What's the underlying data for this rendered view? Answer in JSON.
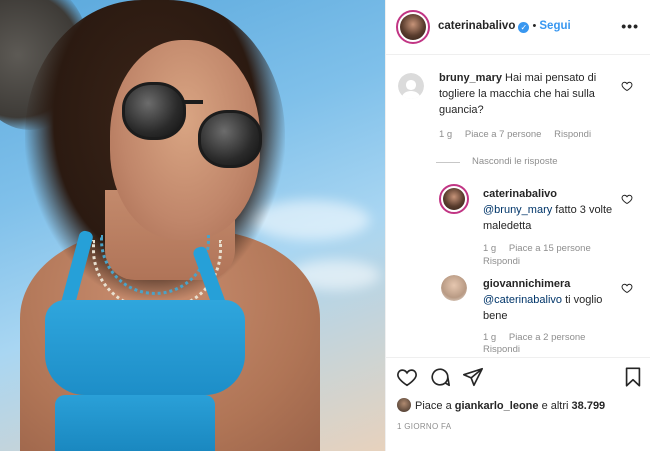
{
  "post": {
    "username": "caterinabalivo",
    "follow_label": "Segui",
    "more_label": "•••",
    "verified_glyph": "✓",
    "date": "1 GIORNO FA"
  },
  "comments": [
    {
      "username": "bruny_mary",
      "text": "Hai mai pensato di togliere la macchia che hai sulla guancia?",
      "time": "1 g",
      "likes": "Piace a 7 persone",
      "reply": "Rispondi"
    }
  ],
  "hide_replies": "Nascondi le risposte",
  "replies": [
    {
      "username": "caterinabalivo",
      "mention": "@bruny_mary",
      "text": " fatto 3 volte maledetta",
      "time": "1 g",
      "likes": "Piace a 15 persone",
      "reply": "Rispondi"
    },
    {
      "username": "giovannichimera",
      "mention": "@caterinabalivo",
      "text": " ti voglio bene",
      "time": "1 g",
      "likes": "Piace a 2 persone",
      "reply": "Rispondi"
    }
  ],
  "likes_line": {
    "prefix": "Piace a ",
    "user": "giankarlo_leone",
    "suffix": " e altri ",
    "count": "38.799"
  },
  "icons": [
    "heart-icon",
    "comment-icon",
    "share-icon",
    "bookmark-icon"
  ],
  "colors": {
    "accent": "#3897f0",
    "ring": "#c13584",
    "muted": "#8e8e8e"
  }
}
